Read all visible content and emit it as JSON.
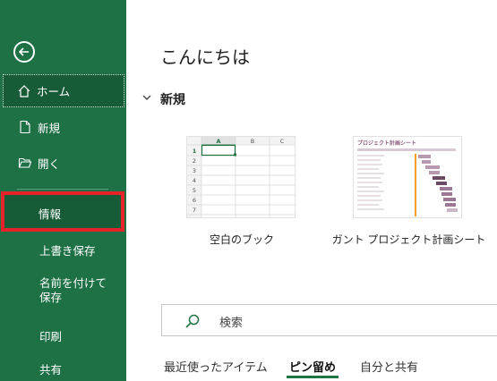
{
  "sidebar": {
    "items": {
      "home": "ホーム",
      "new": "新規",
      "open": "開く",
      "info": "情報",
      "save": "上書き保存",
      "save_as": "名前を付けて保存",
      "print": "印刷",
      "share": "共有"
    },
    "icons": {
      "back": "arrow-left-icon",
      "home": "home-icon",
      "new": "new-document-icon",
      "open": "folder-open-icon"
    },
    "colors": {
      "background": "#1e7145",
      "selected": "#185c37",
      "highlight_border": "#e8222a"
    }
  },
  "main": {
    "greeting": "こんにちは",
    "new_section": {
      "title": "新規",
      "templates": [
        {
          "name": "空白のブック",
          "columns": [
            "A",
            "B",
            "C"
          ],
          "rows": [
            "1",
            "2",
            "3",
            "4",
            "5",
            "6",
            "7"
          ]
        },
        {
          "name": "ガント プロジェクト計画シート",
          "preview_title": "プロジェクト計画シート"
        }
      ]
    },
    "search": {
      "placeholder": "検索",
      "icon": "search-icon"
    },
    "tabs": [
      "最近使ったアイテム",
      "ピン留め",
      "自分と共有"
    ],
    "active_tab": "ピン留め",
    "accent": "#217346"
  }
}
